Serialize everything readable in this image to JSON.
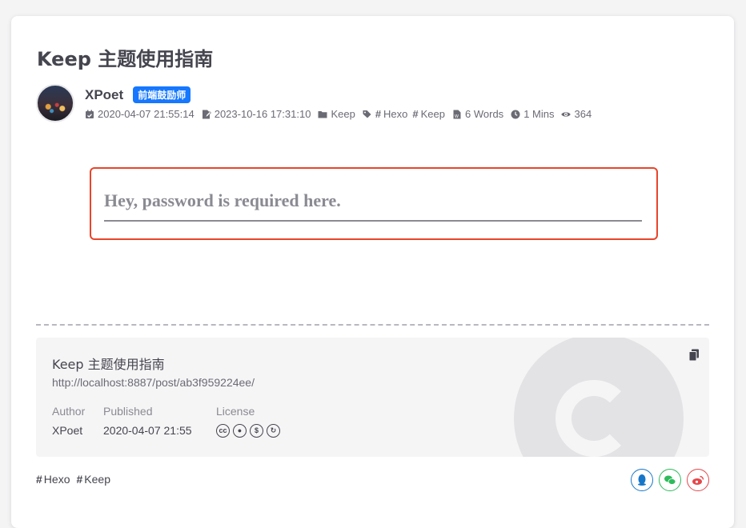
{
  "post": {
    "title": "Keep 主题使用指南",
    "author": "XPoet",
    "badge": "前端鼓励师",
    "meta": {
      "created": "2020-04-07 21:55:14",
      "updated": "2023-10-16 17:31:10",
      "category": "Keep",
      "tags": [
        "Hexo",
        "Keep"
      ],
      "words": "6 Words",
      "read_time": "1 Mins",
      "views": "364"
    }
  },
  "password": {
    "placeholder": "Hey, password is required here.",
    "value": ""
  },
  "copyright": {
    "title": "Keep 主题使用指南",
    "link": "http://localhost:8887/post/ab3f959224ee/",
    "author_label": "Author",
    "author_value": "XPoet",
    "published_label": "Published",
    "published_value": "2020-04-07 21:55",
    "license_label": "License",
    "license_icons": [
      "cc",
      "by",
      "nc",
      "sa"
    ]
  },
  "footer_tags": [
    "Hexo",
    "Keep"
  ],
  "share": [
    {
      "name": "qq",
      "color": "#1677c9"
    },
    {
      "name": "wechat",
      "color": "#2dbb5c"
    },
    {
      "name": "weibo",
      "color": "#e5474b"
    }
  ],
  "colors": {
    "accent_badge": "#1677ff",
    "password_border": "#e8452a"
  }
}
